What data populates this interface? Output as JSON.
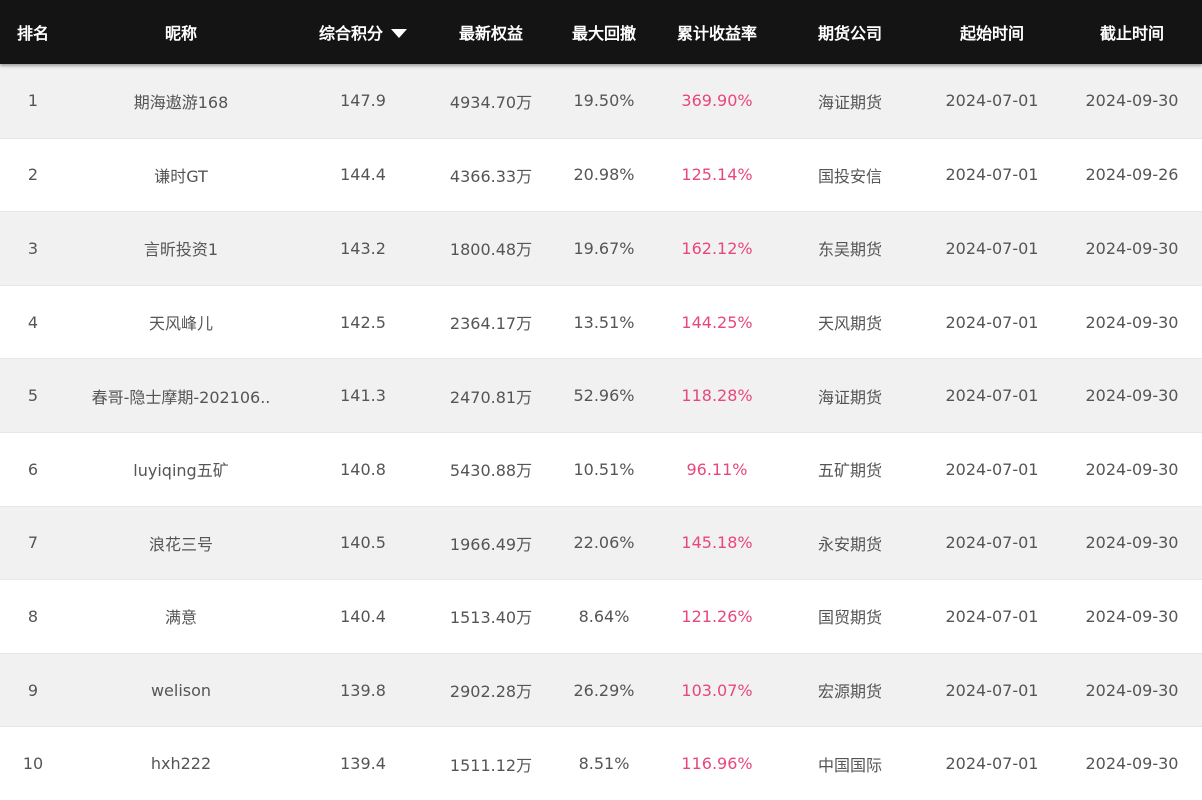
{
  "columns": {
    "rank": "排名",
    "nickname": "昵称",
    "score": "综合积分",
    "equity": "最新权益",
    "drawdown": "最大回撤",
    "return": "累计收益率",
    "company": "期货公司",
    "start": "起始时间",
    "end": "截止时间"
  },
  "sort": {
    "column": "综合积分",
    "direction": "descending",
    "icon": "caret-down-icon"
  },
  "colors": {
    "header_bg": "#141414",
    "row_alt_bg": "#f1f1f1",
    "return_color": "#e8467f",
    "text": "#555555"
  },
  "rows": [
    {
      "rank": "1",
      "nickname": "期海遨游168",
      "score": "147.9",
      "equity": "4934.70万",
      "drawdown": "19.50%",
      "return": "369.90%",
      "company": "海证期货",
      "start": "2024-07-01",
      "end": "2024-09-30"
    },
    {
      "rank": "2",
      "nickname": "谦时GT",
      "score": "144.4",
      "equity": "4366.33万",
      "drawdown": "20.98%",
      "return": "125.14%",
      "company": "国投安信",
      "start": "2024-07-01",
      "end": "2024-09-26"
    },
    {
      "rank": "3",
      "nickname": "言昕投资1",
      "score": "143.2",
      "equity": "1800.48万",
      "drawdown": "19.67%",
      "return": "162.12%",
      "company": "东吴期货",
      "start": "2024-07-01",
      "end": "2024-09-30"
    },
    {
      "rank": "4",
      "nickname": "天风峰儿",
      "score": "142.5",
      "equity": "2364.17万",
      "drawdown": "13.51%",
      "return": "144.25%",
      "company": "天风期货",
      "start": "2024-07-01",
      "end": "2024-09-30"
    },
    {
      "rank": "5",
      "nickname": "春哥-隐士摩期-202106..",
      "score": "141.3",
      "equity": "2470.81万",
      "drawdown": "52.96%",
      "return": "118.28%",
      "company": "海证期货",
      "start": "2024-07-01",
      "end": "2024-09-30"
    },
    {
      "rank": "6",
      "nickname": "luyiqing五矿",
      "score": "140.8",
      "equity": "5430.88万",
      "drawdown": "10.51%",
      "return": "96.11%",
      "company": "五矿期货",
      "start": "2024-07-01",
      "end": "2024-09-30"
    },
    {
      "rank": "7",
      "nickname": "浪花三号",
      "score": "140.5",
      "equity": "1966.49万",
      "drawdown": "22.06%",
      "return": "145.18%",
      "company": "永安期货",
      "start": "2024-07-01",
      "end": "2024-09-30"
    },
    {
      "rank": "8",
      "nickname": "满意",
      "score": "140.4",
      "equity": "1513.40万",
      "drawdown": "8.64%",
      "return": "121.26%",
      "company": "国贸期货",
      "start": "2024-07-01",
      "end": "2024-09-30"
    },
    {
      "rank": "9",
      "nickname": "welison",
      "score": "139.8",
      "equity": "2902.28万",
      "drawdown": "26.29%",
      "return": "103.07%",
      "company": "宏源期货",
      "start": "2024-07-01",
      "end": "2024-09-30"
    },
    {
      "rank": "10",
      "nickname": "hxh222",
      "score": "139.4",
      "equity": "1511.12万",
      "drawdown": "8.51%",
      "return": "116.96%",
      "company": "中国国际",
      "start": "2024-07-01",
      "end": "2024-09-30"
    }
  ]
}
